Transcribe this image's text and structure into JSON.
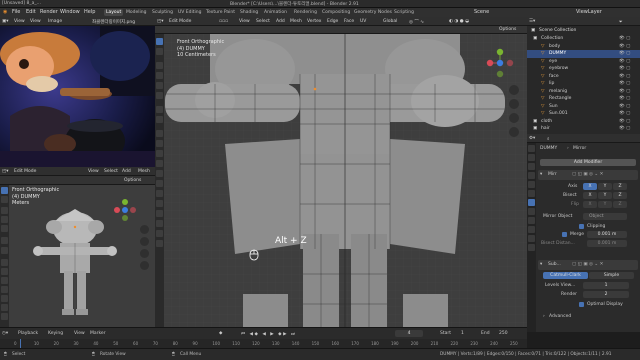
{
  "title_bar": {
    "left_text": "[Unsaved] 8_a_...",
    "title": "Blender* [C:\\Users\\...\\블렌더-튜토리얼.blend] - Blender 2.91",
    "workspace_label": "Scene",
    "view_layer": "ViewLayer"
  },
  "menu": {
    "items": [
      "File",
      "Edit",
      "Render",
      "Window",
      "Help"
    ],
    "tabs": [
      "Layout",
      "Modeling",
      "Sculpting",
      "UV Editing",
      "Texture Paint",
      "Shading",
      "Animation",
      "Rendering",
      "Compositing",
      "Geometry Nodes",
      "Scripting"
    ],
    "active_tab": "Layout"
  },
  "image_editor": {
    "header": {
      "view": "View",
      "view2": "View",
      "image": "Image",
      "image_name": "좌클렌더링이미지.png"
    }
  },
  "small_viewport": {
    "mode": "Edit Mode",
    "menus": [
      "View",
      "Select",
      "Add",
      "Mesh"
    ],
    "options": "Options",
    "overlay_title": "Front Orthographic",
    "overlay_object": "(4) DUMMY",
    "overlay_unit": "Meters"
  },
  "main_viewport": {
    "mode": "Edit Mode",
    "menus": [
      "View",
      "Select",
      "Add",
      "Mesh",
      "Vertex",
      "Edge",
      "Face",
      "UV"
    ],
    "transform": "Global",
    "options": "Options",
    "overlay_title": "Front Orthographic",
    "overlay_object": "(4) DUMMY",
    "overlay_unit": "10 Centimeters",
    "key_hint": "Alt + Z"
  },
  "outliner": {
    "header": "Scene Collection",
    "items": [
      {
        "name": "Collection",
        "indent": 0
      },
      {
        "name": "body",
        "indent": 1
      },
      {
        "name": "DUMMY",
        "indent": 1,
        "selected": true
      },
      {
        "name": "eye",
        "indent": 1
      },
      {
        "name": "eyebrow",
        "indent": 1
      },
      {
        "name": "face",
        "indent": 1
      },
      {
        "name": "lip",
        "indent": 1
      },
      {
        "name": "melanig",
        "indent": 1
      },
      {
        "name": "Rectangle",
        "indent": 1
      },
      {
        "name": "Sun",
        "indent": 1
      },
      {
        "name": "Sun.001",
        "indent": 1
      },
      {
        "name": "cloth",
        "indent": 0
      },
      {
        "name": "hair",
        "indent": 0
      }
    ]
  },
  "properties": {
    "object_name": "DUMMY",
    "modifier_type": "Mirror",
    "add_modifier": "Add Modifier",
    "mirror_mod": {
      "name": "Mirr",
      "axis_label": "Axis",
      "bisect_label": "Bisect",
      "flip_label": "Flip",
      "axes": [
        "X",
        "Y",
        "Z"
      ],
      "mirror_object_label": "Mirror Object",
      "mirror_object_value": "Object",
      "clipping_label": "Clipping",
      "merge_label": "Merge",
      "merge_value": "0.001 m",
      "bisect_distance_label": "Bisect Distan...",
      "bisect_distance_value": "0.001 m"
    },
    "subsurf_mod": {
      "name": "Sub...",
      "tab_catmull": "Catmull-Clark",
      "tab_simple": "Simple",
      "levels_label": "Levels View...",
      "levels_value": "1",
      "render_label": "Render",
      "render_value": "2",
      "optimal_label": "Optimal Display",
      "advanced_label": "Advanced"
    }
  },
  "timeline": {
    "menus": [
      "Playback",
      "Keying",
      "View",
      "Marker"
    ],
    "current_frame": "4",
    "start_label": "Start",
    "start_value": "1",
    "end_label": "End",
    "end_value": "250",
    "ruler_marks": [
      "0",
      "10",
      "20",
      "30",
      "40",
      "50",
      "60",
      "70",
      "80",
      "90",
      "100",
      "110",
      "120",
      "130",
      "140",
      "150",
      "160",
      "170",
      "180",
      "190",
      "200",
      "210",
      "220",
      "230",
      "240",
      "250"
    ]
  },
  "status_bar": {
    "left": "Select",
    "middle": "Rotate View",
    "right_hint": "Call Menu",
    "stats": "DUMMY | Verts:1/89 | Edges:0/150 | Faces:0/71 | Tris:0/122 | Objects:1/11 | 2.91"
  },
  "colors": {
    "accent": "#4772b3",
    "viewport_bg": "#3e3e3e",
    "selected_row": "#334d80",
    "header": "#2f2f2f"
  }
}
